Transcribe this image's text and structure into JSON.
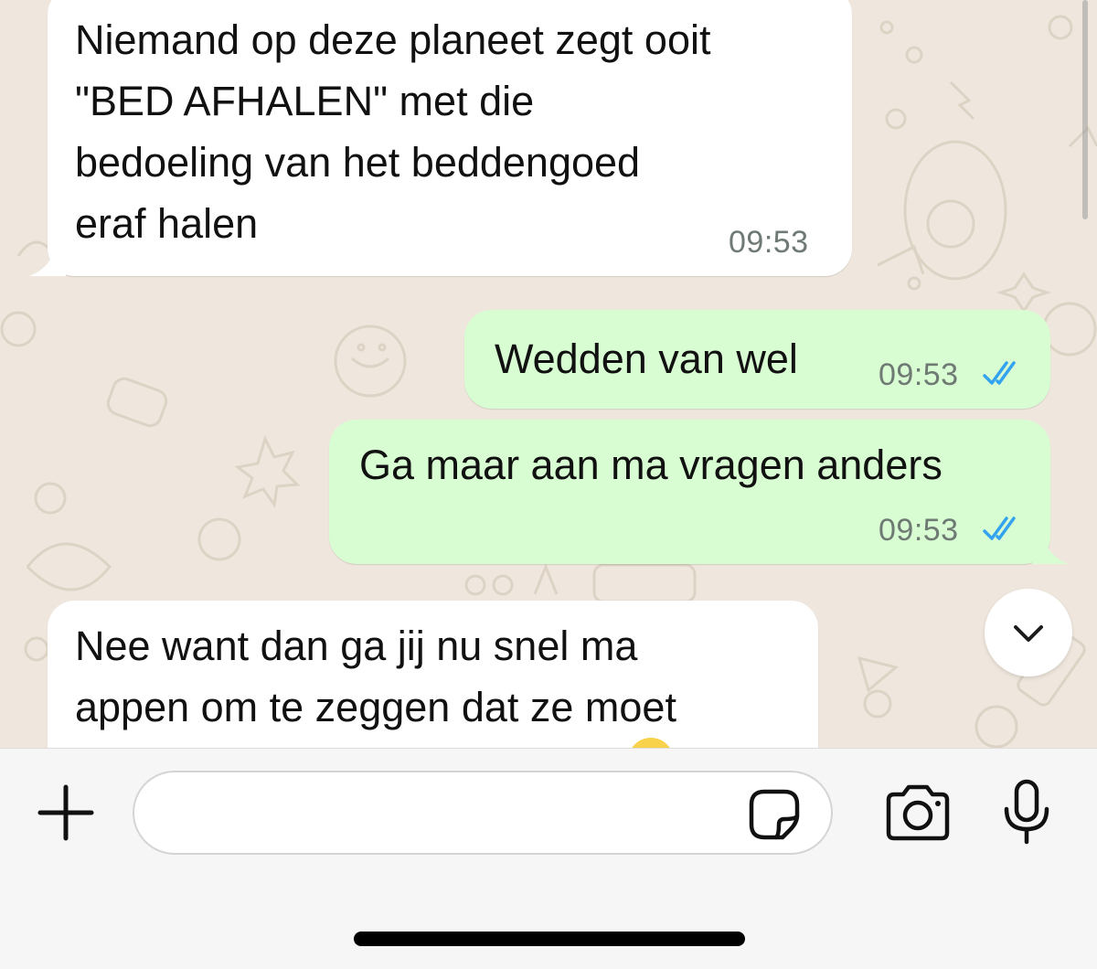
{
  "messages": [
    {
      "direction": "incoming",
      "text": "Niemand op deze planeet zegt ooit\n\"BED AFHALEN\" met die\nbedoeling van het beddengoed\neraf halen",
      "time": "09:53"
    },
    {
      "direction": "outgoing",
      "text": "Wedden van wel",
      "time": "09:53",
      "status": "read"
    },
    {
      "direction": "outgoing",
      "text": "Ga maar aan ma vragen anders",
      "time": "09:53",
      "status": "read"
    },
    {
      "direction": "incoming",
      "text": "Nee want dan ga jij nu snel ma\nappen om te zeggen dat ze moet"
    }
  ],
  "composer": {
    "placeholder": "",
    "value": "",
    "icons": {
      "attach": "plus-icon",
      "sticker": "sticker-icon",
      "camera": "camera-icon",
      "voice": "microphone-icon"
    }
  },
  "scroll_button_icon": "chevron-down-icon",
  "colors": {
    "chat_background": "#efe7dd",
    "incoming_bubble": "#ffffff",
    "outgoing_bubble": "#d9fdd3",
    "read_ticks": "#34a3ef",
    "timestamp": "#6e7a73"
  }
}
